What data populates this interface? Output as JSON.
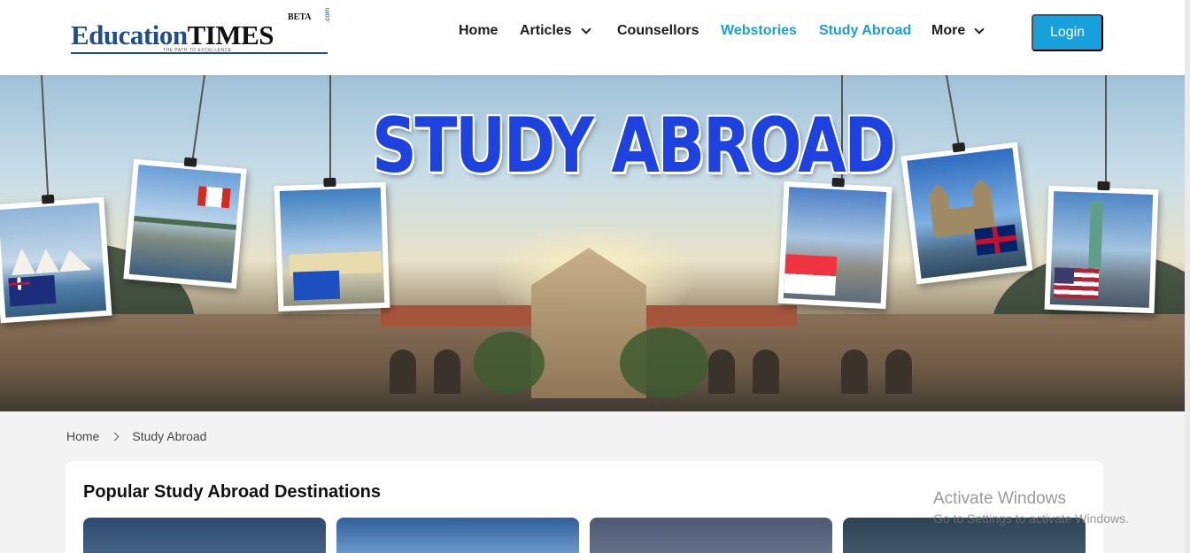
{
  "brand": {
    "logo_text_primary": "Education",
    "logo_text_secondary": "TIMES",
    "logo_beta": "BETA",
    "logo_com": ".com",
    "logo_tagline": "THE PATH TO EXCELLENCE"
  },
  "nav": {
    "items": [
      {
        "label": "Home",
        "has_dropdown": false,
        "active": false
      },
      {
        "label": "Articles",
        "has_dropdown": true,
        "active": false
      },
      {
        "label": "Counsellors",
        "has_dropdown": false,
        "active": false
      },
      {
        "label": "Webstories",
        "has_dropdown": false,
        "active": true
      },
      {
        "label": "Study Abroad",
        "has_dropdown": false,
        "active": true
      },
      {
        "label": "More",
        "has_dropdown": true,
        "active": false
      }
    ],
    "login_label": "Login"
  },
  "hero": {
    "title": "STUDY ABROAD",
    "photos": [
      "australia",
      "canada",
      "europe",
      "singapore",
      "united-kingdom",
      "united-states"
    ]
  },
  "breadcrumb": {
    "items": [
      "Home",
      "Study Abroad"
    ]
  },
  "destinations": {
    "heading": "Popular Study Abroad Destinations"
  },
  "overlay": {
    "activate_title": "Activate Windows",
    "activate_sub": "Go to Settings to activate Windows."
  },
  "colors": {
    "accent": "#16a1dd",
    "nav_active": "#1a9fd8",
    "hero_title": "#1e42e0",
    "logo_blue": "#1f4e8c"
  }
}
